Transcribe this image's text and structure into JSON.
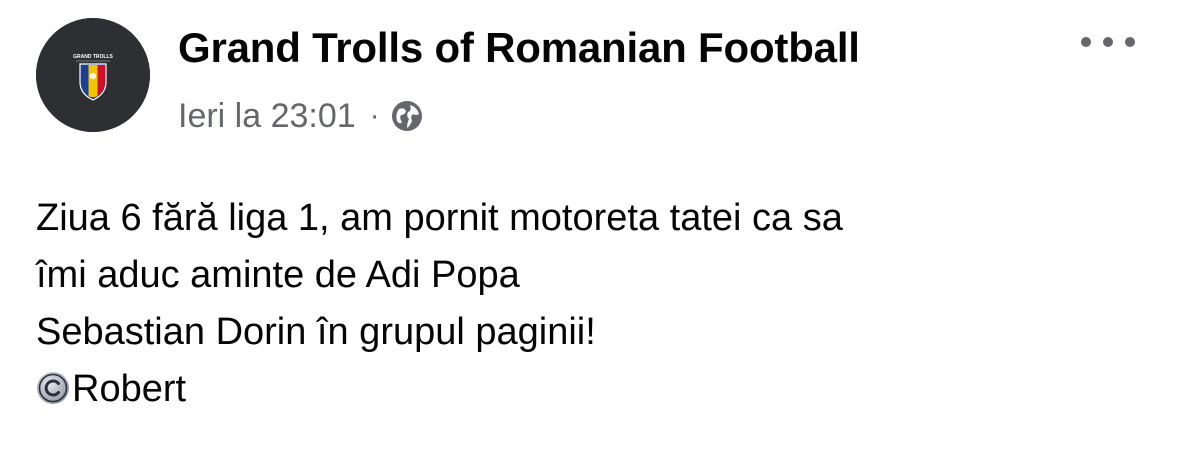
{
  "post": {
    "page_name": "Grand Trolls of Romanian Football",
    "timestamp": "Ieri la 23:01",
    "separator": "·",
    "audience_icon": "globe-icon",
    "more_icon": "more-options-icon",
    "avatar_logo_text": "GRAND TROLLS",
    "text_lines": [
      "Ziua 6 fără liga 1, am pornit motoreta tatei ca sa",
      "îmi aduc aminte de Adi Popa",
      "Sebastian Dorin în grupul paginii!"
    ],
    "signature_icon": "copyright-icon",
    "signature": "Robert"
  },
  "colors": {
    "text_primary": "#050505",
    "text_secondary": "#65676b",
    "avatar_bg": "#2e2f33",
    "flag_blue": "#1c3f94",
    "flag_yellow": "#f5c400",
    "flag_red": "#d0102b"
  }
}
